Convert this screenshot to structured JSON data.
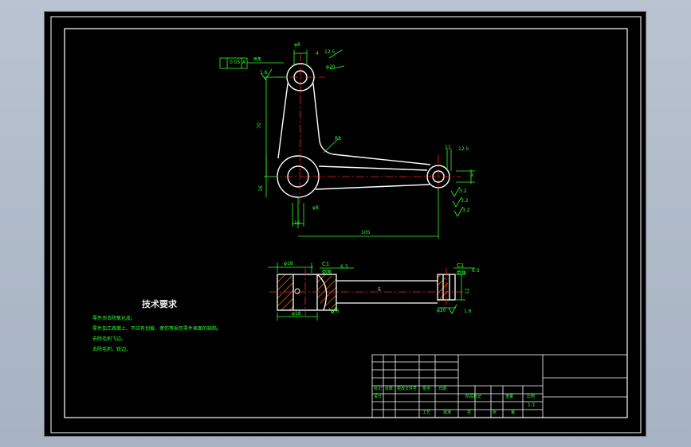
{
  "colors": {
    "background": "#000000",
    "frame": "#ffffff",
    "dimension": "#00ff00",
    "centerline": "#ff0000",
    "part": "#ffffff",
    "hatch": "#ff6a00"
  },
  "dimensions": {
    "top_boss": "φ8",
    "top_hole_depth": "4",
    "top_angle": "12.5",
    "top_dia": "φ20",
    "flatness": "0.05",
    "flatness_ref": "A",
    "finish_top": "1.6",
    "finish_top_label": "倒角",
    "vertical_length": "70",
    "arm_radius": "R8",
    "left_offset": "16",
    "bottom_dim": "φ8",
    "bottom_width": "16",
    "horizontal_length": "105",
    "right_width": "11",
    "right_angle": "12.5",
    "right_height": "9",
    "right_finish_a": "3.2",
    "right_finish_b": "3.2",
    "right_finish_c": "3.2",
    "section_bore": "φ18",
    "section_chamfer": "C1",
    "section_chamfer_text": "倒角",
    "section_finish": "6.3",
    "section_width": "5",
    "section_left_dia": "φ18",
    "section_left_finish": "1.6",
    "section_right_chamfer": "C1",
    "section_right_text": "倒角",
    "section_right_finish": "6.3",
    "section_right_dia": "φ20",
    "section_right_finish_b": "1.6",
    "section_right_height": "12"
  },
  "tech_requirements": {
    "title": "技术要求",
    "items": [
      "零件须去除氧化皮。",
      "零件加工表面上，不应有划痕、擦伤等损伤零件表面的缺陷。",
      "去除毛刺飞边。",
      "去除毛刺，锐边。"
    ]
  },
  "title_block": {
    "mark": "标记",
    "count": "处数",
    "zone": "更改文件号",
    "sign": "签字",
    "date": "日期",
    "design": "设计",
    "stage_mark": "阶段标记",
    "weight": "重量",
    "scale": "比例",
    "scale_value": "1:1",
    "process": "工艺",
    "approve": "批准",
    "sheet_total": "共",
    "sheet_label": "张",
    "sheet_no": "第"
  }
}
